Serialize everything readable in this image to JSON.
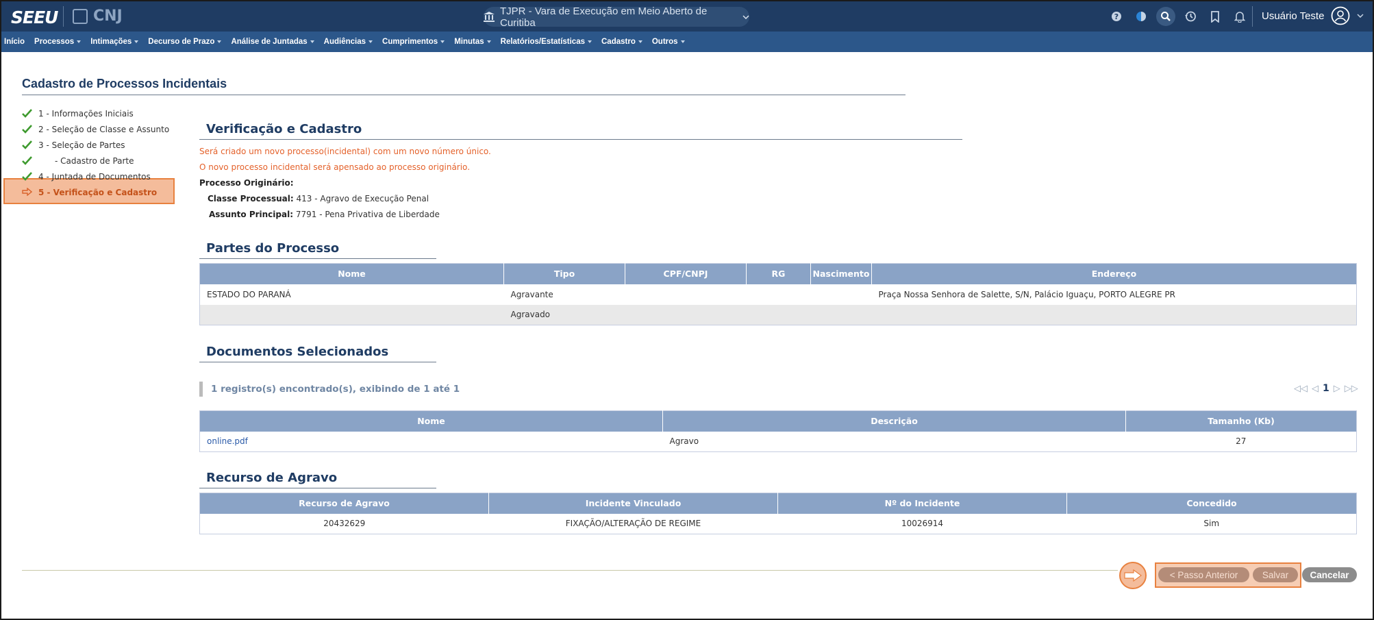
{
  "header": {
    "logo": "SEEU",
    "cnj": "CNJ",
    "court": "TJPR - Vara de Execução em Meio Aberto de Curitiba",
    "user": "Usuário Teste"
  },
  "menu": [
    {
      "label": "Início",
      "dropdown": false
    },
    {
      "label": "Processos",
      "dropdown": true
    },
    {
      "label": "Intimações",
      "dropdown": true
    },
    {
      "label": "Decurso de Prazo",
      "dropdown": true
    },
    {
      "label": "Análise de Juntadas",
      "dropdown": true
    },
    {
      "label": "Audiências",
      "dropdown": true
    },
    {
      "label": "Cumprimentos",
      "dropdown": true
    },
    {
      "label": "Minutas",
      "dropdown": true
    },
    {
      "label": "Relatórios/Estatísticas",
      "dropdown": true
    },
    {
      "label": "Cadastro",
      "dropdown": true
    },
    {
      "label": "Outros",
      "dropdown": true
    }
  ],
  "page_title": "Cadastro de Processos Incidentais",
  "steps": [
    {
      "label": "1 - Informações Iniciais",
      "done": true
    },
    {
      "label": "2 - Seleção de Classe e Assunto",
      "done": true
    },
    {
      "label": "3 - Seleção de Partes",
      "done": true
    },
    {
      "label": "- Cadastro de Parte",
      "done": true
    },
    {
      "label": "4 - Juntada de Documentos",
      "done": true
    },
    {
      "label": "5 - Verificação e Cadastro",
      "done": false
    }
  ],
  "verificacao": {
    "title": "Verificação e Cadastro",
    "msg1": "Será criado um novo processo(incidental) com um novo número único.",
    "msg2": "O novo processo incidental será apensado ao processo originário.",
    "origin_label": "Processo Originário:",
    "classe_label": "Classe Processual:",
    "classe_value": "413 - Agravo de Execução Penal",
    "assunto_label": "Assunto Principal:",
    "assunto_value": "7791 - Pena Privativa de Liberdade"
  },
  "partes": {
    "title": "Partes do Processo",
    "columns": [
      "Nome",
      "Tipo",
      "CPF/CNPJ",
      "RG",
      "Nascimento",
      "Endereço"
    ],
    "rows": [
      [
        "ESTADO DO PARANÁ",
        "Agravante",
        "",
        "",
        "",
        "Praça Nossa Senhora de Salette, S/N, Palácio Iguaçu, PORTO ALEGRE PR"
      ],
      [
        "",
        "Agravado",
        "",
        "",
        "",
        ""
      ]
    ]
  },
  "documentos": {
    "title": "Documentos Selecionados",
    "count_text": "1 registro(s) encontrado(s), exibindo de 1 até 1",
    "page": "1",
    "columns": [
      "Nome",
      "Descrição",
      "Tamanho (Kb)"
    ],
    "rows": [
      [
        "online.pdf",
        "Agravo",
        "27"
      ]
    ]
  },
  "recurso": {
    "title": "Recurso de Agravo",
    "columns": [
      "Recurso de Agravo",
      "Incidente Vinculado",
      "Nº do Incidente",
      "Concedido"
    ],
    "rows": [
      [
        "20432629",
        "FIXAÇÃO/ALTERAÇÃO DE REGIME",
        "10026914",
        "Sim"
      ]
    ]
  },
  "buttons": {
    "prev": "< Passo Anterior",
    "save": "Salvar",
    "cancel": "Cancelar"
  },
  "colors": {
    "topbar": "#1f3c63",
    "menubar": "#2c578a",
    "highlight": "#e8813f",
    "table_header": "#8aa3c6",
    "warning": "#e4612a"
  }
}
